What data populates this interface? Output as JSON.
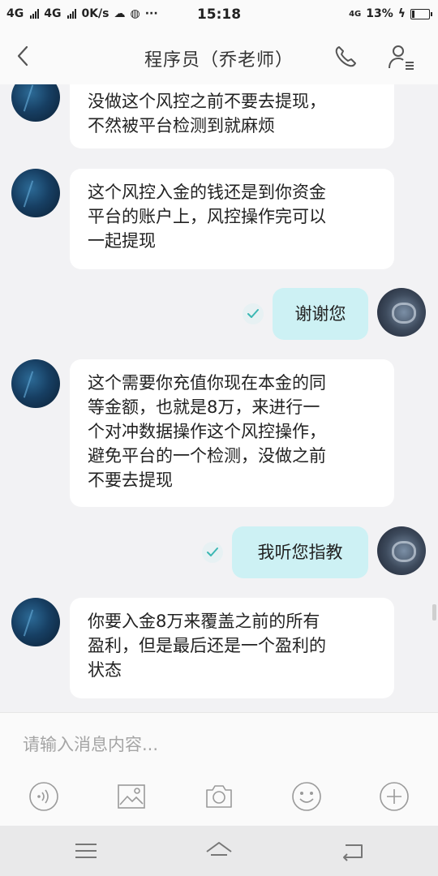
{
  "status_bar": {
    "network1": "4G",
    "network2": "4G",
    "speed": "0K/s",
    "extra": "···",
    "time": "15:18",
    "network_right": "4G",
    "battery_percent": "13%",
    "battery_level": 0.13
  },
  "header": {
    "title": "程序员（乔老师）",
    "back_icon": "chevron-left-icon",
    "call_icon": "phone-icon",
    "profile_icon": "person-menu-icon"
  },
  "messages": [
    {
      "from": "other",
      "text": "没做这个风控之前不要去提现，\n不然被平台检测到就麻烦"
    },
    {
      "from": "other",
      "text": "这个风控入金的钱还是到你资金\n平台的账户上，风控操作完可以\n一起提现"
    },
    {
      "from": "me",
      "text": "谢谢您",
      "status": "read"
    },
    {
      "from": "other",
      "text": "这个需要你充值你现在本金的同\n等金额，也就是8万，来进行一\n个对冲数据操作这个风控操作，\n避免平台的一个检测，没做之前\n不要去提现"
    },
    {
      "from": "me",
      "text": "我听您指教",
      "status": "read"
    },
    {
      "from": "other",
      "text": "你要入金8万来覆盖之前的所有\n盈利，但是最后还是一个盈利的\n状态"
    }
  ],
  "composer": {
    "placeholder": "请输入消息内容...",
    "tools": [
      "voice-icon",
      "image-icon",
      "camera-icon",
      "emoji-icon",
      "plus-icon"
    ]
  },
  "nav_bar": [
    "menu-icon",
    "home-icon",
    "back-icon"
  ],
  "colors": {
    "outgoing_bubble": "#cdf1f4",
    "incoming_bubble": "#ffffff",
    "read_check": "#3bb7b3",
    "background": "#f2f2f4"
  }
}
